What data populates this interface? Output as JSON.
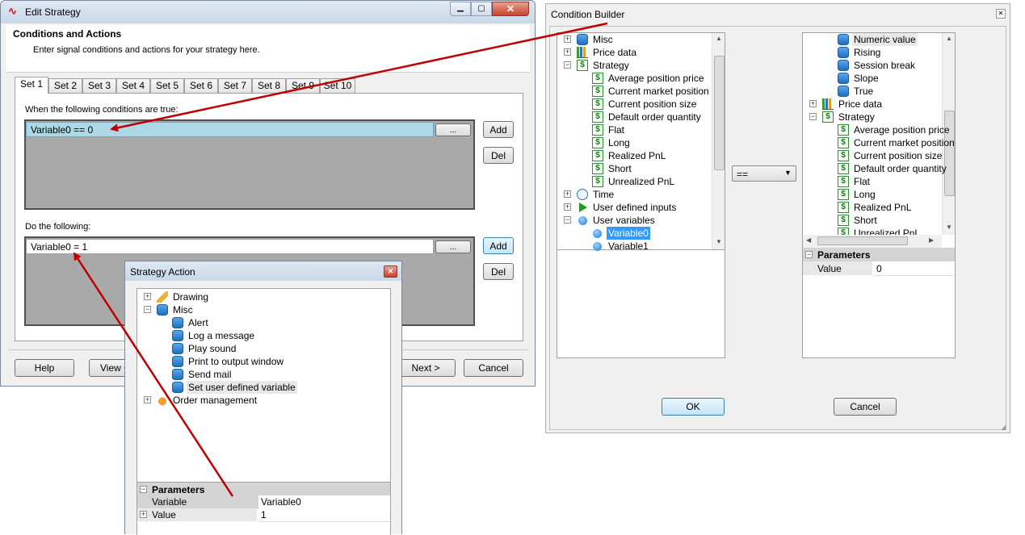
{
  "edit_strategy": {
    "title": "Edit Strategy",
    "header": "Conditions and Actions",
    "subheader": "Enter signal conditions and actions for your strategy here.",
    "tabs": [
      "Set 1",
      "Set 2",
      "Set 3",
      "Set 4",
      "Set 5",
      "Set 6",
      "Set 7",
      "Set 8",
      "Set 9",
      "Set 10"
    ],
    "conditions_label": "When the following conditions are true:",
    "condition_value": "Variable0 == 0",
    "actions_label": "Do the following:",
    "action_value": "Variable0 = 1",
    "ellipsis": "...",
    "add": "Add",
    "del": "Del",
    "help": "Help",
    "view": "View C",
    "next": "Next >",
    "cancel": "Cancel"
  },
  "condition_builder": {
    "title": "Condition Builder",
    "left_tree": [
      "Misc",
      "Price data",
      "Strategy",
      "Average position price",
      "Current market position",
      "Current position size",
      "Default order quantity",
      "Flat",
      "Long",
      "Realized PnL",
      "Short",
      "Unrealized PnL",
      "Time",
      "User defined inputs",
      "User variables",
      "Variable0",
      "Variable1"
    ],
    "operator": "==",
    "right_tree": [
      "Numeric value",
      "Rising",
      "Session break",
      "Slope",
      "True",
      "Price data",
      "Strategy",
      "Average position price",
      "Current market position",
      "Current position size",
      "Default order quantity",
      "Flat",
      "Long",
      "Realized PnL",
      "Short",
      "Unrealized PnL"
    ],
    "parameters_label": "Parameters",
    "param_name": "Value",
    "param_value": "0",
    "ok": "OK",
    "cancel": "Cancel"
  },
  "strategy_action": {
    "title": "Strategy Action",
    "tree": [
      "Drawing",
      "Misc",
      "Alert",
      "Log a message",
      "Play sound",
      "Print to output window",
      "Send mail",
      "Set user defined variable",
      "Order management"
    ],
    "parameters_label": "Parameters",
    "param1_name": "Variable",
    "param1_value": "Variable0",
    "param2_name": "Value",
    "param2_value": "1"
  },
  "colors": {
    "selection": "#add8e6",
    "tree_highlight": "#3399ff",
    "arrow": "#c00000",
    "dialog_bg": "#f0f0f0"
  }
}
